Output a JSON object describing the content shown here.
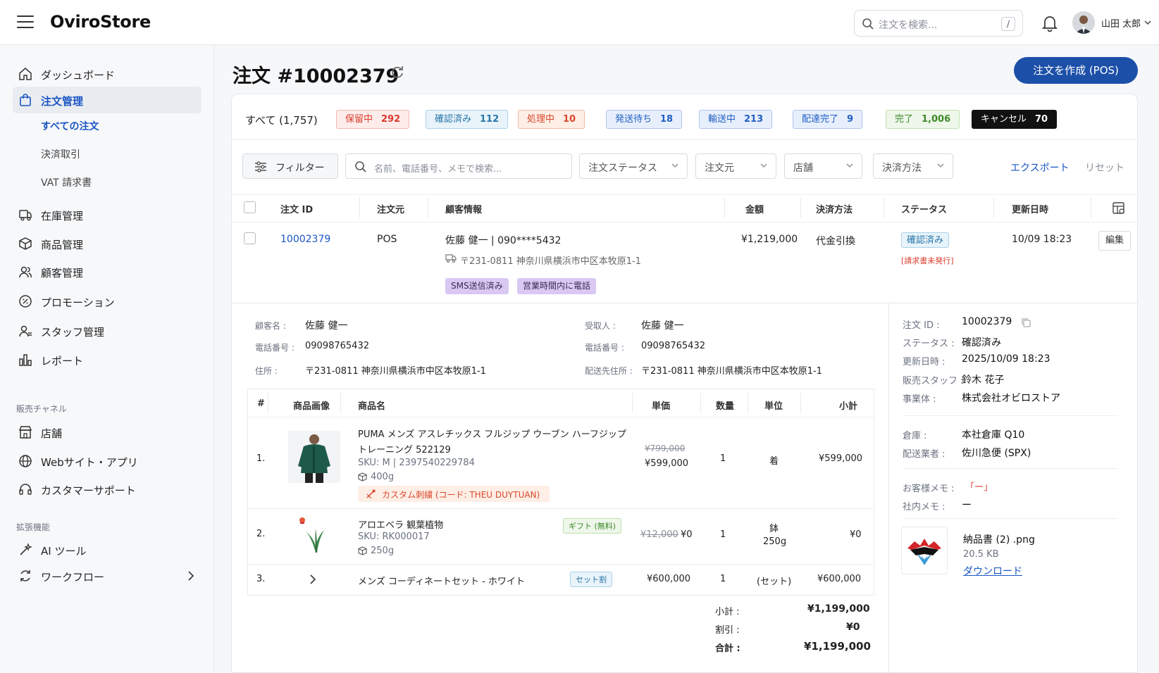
{
  "app": {
    "name": "OviroStore"
  },
  "header": {
    "search_placeholder": "注文を検索...",
    "search_shortcut": "/",
    "user_name": "山田 太郎"
  },
  "sidebar": {
    "items": [
      {
        "label": "ダッシュボード",
        "icon": "home-icon"
      },
      {
        "label": "注文管理",
        "icon": "shopping-bag-icon"
      },
      {
        "label": "在庫管理",
        "icon": "inventory-truck-icon"
      },
      {
        "label": "商品管理",
        "icon": "box-icon"
      },
      {
        "label": "顧客管理",
        "icon": "users-icon"
      },
      {
        "label": "プロモーション",
        "icon": "percent-badge-icon"
      },
      {
        "label": "スタッフ管理",
        "icon": "staff-icon"
      },
      {
        "label": "レポート",
        "icon": "bar-chart-icon"
      }
    ],
    "order_sub": [
      "すべての注文",
      "決済取引",
      "VAT 請求書"
    ],
    "channels_title": "販売チャネル",
    "channels": [
      {
        "label": "店舗",
        "icon": "store-icon"
      },
      {
        "label": "Webサイト・アプリ",
        "icon": "globe-icon"
      },
      {
        "label": "カスタマーサポート",
        "icon": "headset-icon"
      }
    ],
    "ext_title": "拡張機能",
    "ext": [
      {
        "label": "AI ツール",
        "icon": "magic-wand-icon"
      },
      {
        "label": "ワークフロー",
        "icon": "workflow-icon"
      }
    ]
  },
  "page": {
    "title": "注文 #10002379",
    "create_button": "注文を作成 (POS)"
  },
  "status_tabs": {
    "all": "すべて (1,757)",
    "chips": [
      {
        "label": "保留中",
        "count": "292",
        "color": "#d93a2b",
        "bg": "#fdecea",
        "border": "#f3b7b0"
      },
      {
        "label": "確認済み",
        "count": "112",
        "color": "#2777a8",
        "bg": "#e8f3fa",
        "border": "#a9d2ea"
      },
      {
        "label": "処理中",
        "count": "10",
        "color": "#d9482b",
        "bg": "#fdeee6",
        "border": "#f2b9a3"
      },
      {
        "label": "発送待ち",
        "count": "18",
        "color": "#1f5fc4",
        "bg": "#e8effc",
        "border": "#aec5ef"
      },
      {
        "label": "輸送中",
        "count": "213",
        "color": "#1f5fc4",
        "bg": "#e8effc",
        "border": "#aec5ef"
      },
      {
        "label": "配達完了",
        "count": "9",
        "color": "#1f5fc4",
        "bg": "#e8effc",
        "border": "#aec5ef"
      },
      {
        "label": "完了",
        "count": "1,006",
        "color": "#3f8a2b",
        "bg": "#eef7ea",
        "border": "#bfe0b1"
      },
      {
        "label": "キャンセル",
        "count": "70",
        "color": "#ffffff",
        "bg": "#111111",
        "border": "#111111"
      }
    ]
  },
  "filters": {
    "filter_button": "フィルター",
    "search_placeholder": "名前、電話番号、メモで検索...",
    "selects": [
      "注文ステータス",
      "注文元",
      "店舗",
      "決済方法"
    ],
    "export": "エクスポート",
    "reset": "リセット"
  },
  "table": {
    "headers": [
      "注文 ID",
      "注文元",
      "顧客情報",
      "金額",
      "決済方法",
      "ステータス",
      "更新日時"
    ],
    "row": {
      "id": "10002379",
      "source": "POS",
      "customer": "佐藤 健一 | 090****5432",
      "address": "〒231-0811 神奈川県横浜市中区本牧原1-1",
      "amount": "¥1,219,000",
      "payment": "代金引換",
      "status": "確認済み",
      "invoice_note": "[請求書未発行]",
      "updated": "10/09 18:23",
      "edit": "編集",
      "tags": [
        "SMS送信済み",
        "営業時間内に電話"
      ]
    }
  },
  "detail": {
    "customer": {
      "name_label": "顧客名 :",
      "name": "佐藤 健一",
      "phone_label": "電話番号 :",
      "phone": "09098765432",
      "addr_label": "住所 :",
      "addr": "〒231-0811 神奈川県横浜市中区本牧原1-1"
    },
    "recipient": {
      "name_label": "受取人 :",
      "name": "佐藤 健一",
      "phone_label": "電話番号 :",
      "phone": "09098765432",
      "addr_label": "配送先住所 :",
      "addr": "〒231-0811 神奈川県横浜市中区本牧原1-1"
    },
    "items_headers": [
      "#",
      "商品画像",
      "商品名",
      "単価",
      "数量",
      "単位",
      "小計"
    ],
    "items": [
      {
        "no": "1.",
        "name1": "PUMA メンズ アスレチックス フルジップ ウーブン ハーフジップ",
        "name2": "トレーニング 522129",
        "sku": "SKU: M | 2397540229784",
        "weight": "400g",
        "custom": "カスタム刺繍 (コード: THEU DUYTUAN)",
        "old_price": "¥799,000",
        "price": "¥599,000",
        "qty": "1",
        "unit": "着",
        "subtotal": "¥599,000"
      },
      {
        "no": "2.",
        "name1": "アロエベラ 観葉植物",
        "sku": "SKU: RK000017",
        "weight": "250g",
        "gift": "ギフト (無料)",
        "old_price": "¥12,000",
        "price": "¥0",
        "qty": "1",
        "unit1": "鉢",
        "unit2": "250g",
        "subtotal": "¥0"
      },
      {
        "no": "3.",
        "name1": "メンズ コーディネートセット - ホワイト",
        "set": "セット割",
        "price": "¥600,000",
        "qty": "1",
        "unit": "(セット)",
        "subtotal": "¥600,000"
      }
    ],
    "totals": {
      "subtotal_label": "小計 :",
      "subtotal": "¥1,199,000",
      "discount_label": "割引 :",
      "discount": "¥0",
      "total_label": "合計 :",
      "total": "¥1,199,000"
    }
  },
  "side": {
    "order_id_label": "注文 ID :",
    "order_id": "10002379",
    "status_label": "ステータス :",
    "status": "確認済み",
    "updated_label": "更新日時 :",
    "updated": "2025/10/09 18:23",
    "staff_label": "販売スタッフ :",
    "staff": "鈴木 花子",
    "company_label": "事業体 :",
    "company": "株式会社オビロストア",
    "warehouse_label": "倉庫 :",
    "warehouse": "本社倉庫 Q10",
    "carrier_label": "配送業者 :",
    "carrier": "佐川急便 (SPX)",
    "cust_memo_label": "お客様メモ :",
    "cust_memo": "「ー」",
    "internal_memo_label": "社内メモ :",
    "internal_memo": "ー",
    "file_name": "納品書 (2) .png",
    "file_size": "20.5 KB",
    "download": "ダウンロード"
  }
}
